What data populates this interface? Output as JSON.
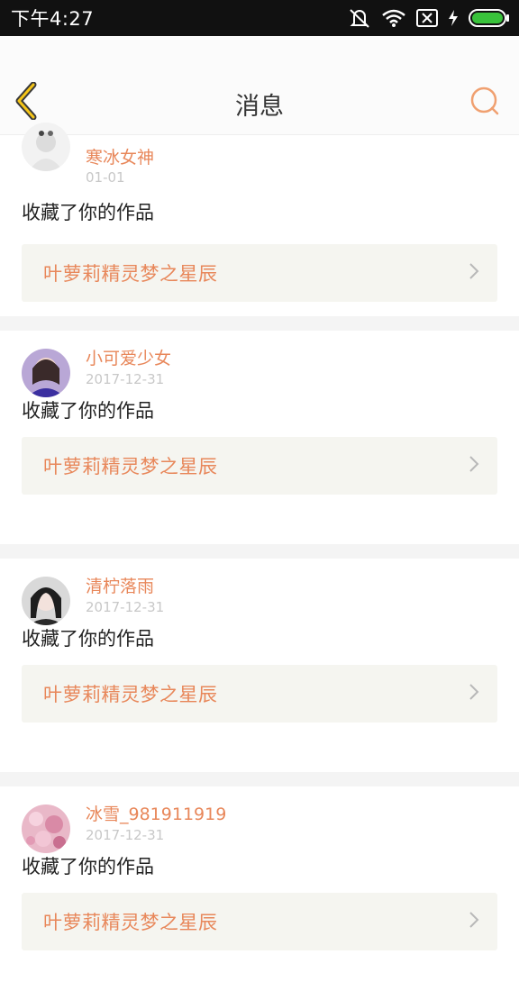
{
  "status_bar": {
    "time": "下午4:27"
  },
  "header": {
    "title": "消息",
    "back_icon": "chevron-left-icon",
    "search_icon": "search-icon",
    "accent": "#e8875a"
  },
  "messages": [
    {
      "username": "寒冰女神",
      "date": "01-01",
      "action": "收藏了你的作品",
      "work_title": "叶萝莉精灵梦之星辰"
    },
    {
      "username": "小可爱少女",
      "date": "2017-12-31",
      "action": "收藏了你的作品",
      "work_title": "叶萝莉精灵梦之星辰"
    },
    {
      "username": "清柠落雨",
      "date": "2017-12-31",
      "action": "收藏了你的作品",
      "work_title": "叶萝莉精灵梦之星辰"
    },
    {
      "username": "冰雪_981911919",
      "date": "2017-12-31",
      "action": "收藏了你的作品",
      "work_title": "叶萝莉精灵梦之星辰"
    }
  ]
}
